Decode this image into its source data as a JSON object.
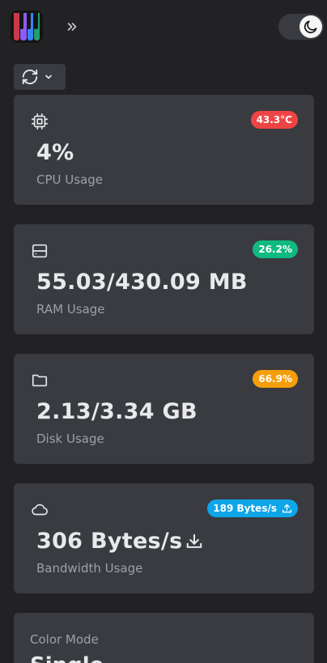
{
  "header": {
    "logo_icon": "piano-keys-logo",
    "expand_icon": "chevrons-right-icon",
    "theme_icon": "moon-icon"
  },
  "refresh": {
    "icon": "refresh-icon",
    "dropdown_icon": "chevron-down-icon"
  },
  "cards": {
    "cpu": {
      "icon": "cpu-chip-icon",
      "badge": "43.3°C",
      "value": "4%",
      "label": "CPU Usage",
      "badge_color": "#ef4444"
    },
    "ram": {
      "icon": "server-icon",
      "badge": "26.2%",
      "value": "55.03/430.09 MB",
      "label": "RAM Usage",
      "badge_color": "#10b981"
    },
    "disk": {
      "icon": "folder-icon",
      "badge": "66.9%",
      "value": "2.13/3.34 GB",
      "label": "Disk Usage",
      "badge_color": "#f59e0b"
    },
    "bandwidth": {
      "icon": "cloud-icon",
      "badge": "189 Bytes/s",
      "badge_icon": "upload-icon",
      "value": "306 Bytes/s",
      "value_icon": "download-icon",
      "label": "Bandwidth Usage",
      "badge_color": "#0ea5e9"
    },
    "color_mode": {
      "label": "Color Mode",
      "value": "Single"
    }
  }
}
